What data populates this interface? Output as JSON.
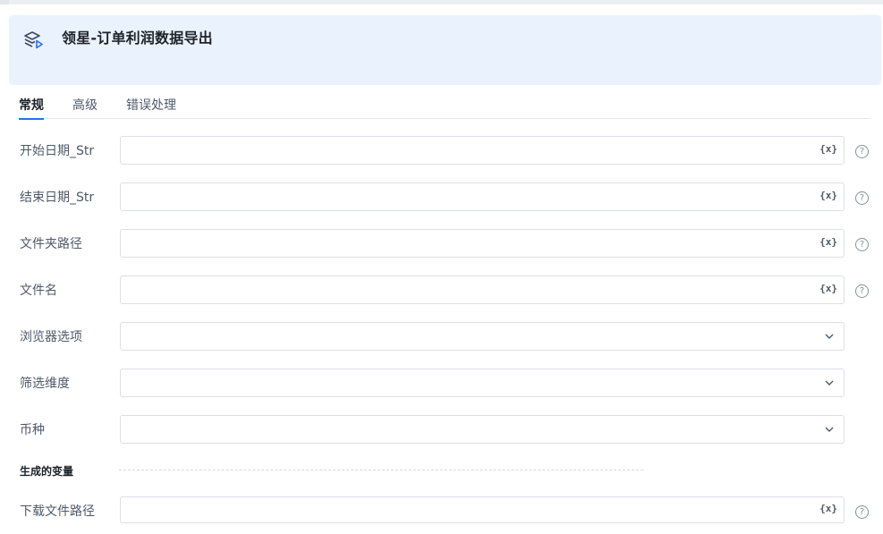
{
  "header": {
    "title": "领星-订单利润数据导出",
    "icon": "box-play-icon"
  },
  "tabs": [
    {
      "label": "常规",
      "active": true
    },
    {
      "label": "高级",
      "active": false
    },
    {
      "label": "错误处理",
      "active": false
    }
  ],
  "fields": {
    "start_date": {
      "label": "开始日期_Str",
      "value": "",
      "var_label": "{x}"
    },
    "end_date": {
      "label": "结束日期_Str",
      "value": "",
      "var_label": "{x}"
    },
    "folder_path": {
      "label": "文件夹路径",
      "value": "",
      "var_label": "{x}"
    },
    "file_name": {
      "label": "文件名",
      "value": "",
      "var_label": "{x}"
    },
    "browser_option": {
      "label": "浏览器选项",
      "value": ""
    },
    "filter_dimension": {
      "label": "筛选维度",
      "value": ""
    },
    "currency": {
      "label": "币种",
      "value": ""
    }
  },
  "output": {
    "section_label": "生成的变量",
    "download_path": {
      "label": "下载文件路径",
      "value": "",
      "var_label": "{x}"
    }
  },
  "help_glyph": "?",
  "colors": {
    "accent": "#2a6ef5",
    "header_bg": "#eaf2fe",
    "border": "#dcdfe6"
  }
}
